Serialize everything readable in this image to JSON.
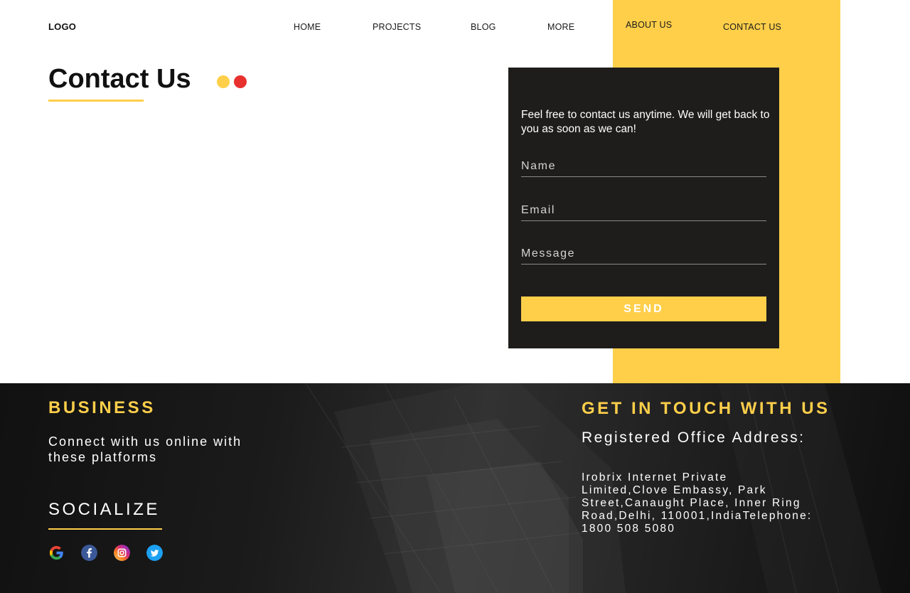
{
  "header": {
    "logo": "LOGO",
    "nav": {
      "home": "HOME",
      "projects": "PROJECTS",
      "blog": "BLOG",
      "more": "MORE",
      "about": "ABOUT US",
      "contact": "CONTACT US"
    }
  },
  "main": {
    "title": "Contact Us"
  },
  "form": {
    "intro": "Feel free to contact us anytime. We will get back to you as soon as we can!",
    "name_placeholder": "Name",
    "email_placeholder": "Email",
    "message_placeholder": "Message",
    "send_label": "SEND"
  },
  "footer": {
    "business_heading": "BUSINESS",
    "connect_text": "Connect with us online with these platforms",
    "socialize_heading": "SOCIALIZE",
    "social_icons": [
      "google-icon",
      "facebook-icon",
      "instagram-icon",
      "twitter-icon"
    ],
    "touch_heading": "GET IN TOUCH WITH US",
    "office_label": "Registered Office Address:",
    "address": "Irobrix Internet Private Limited,Clove Embassy, Park Street,Canaught Place, Inner Ring Road,Delhi, 110001,IndiaTelephone: 1800 508 5080"
  },
  "colors": {
    "accent_yellow": "#ffcf4a",
    "accent_red": "#e8312e",
    "form_background": "#1e1d1b",
    "footer_background": "#1a1a1a"
  }
}
